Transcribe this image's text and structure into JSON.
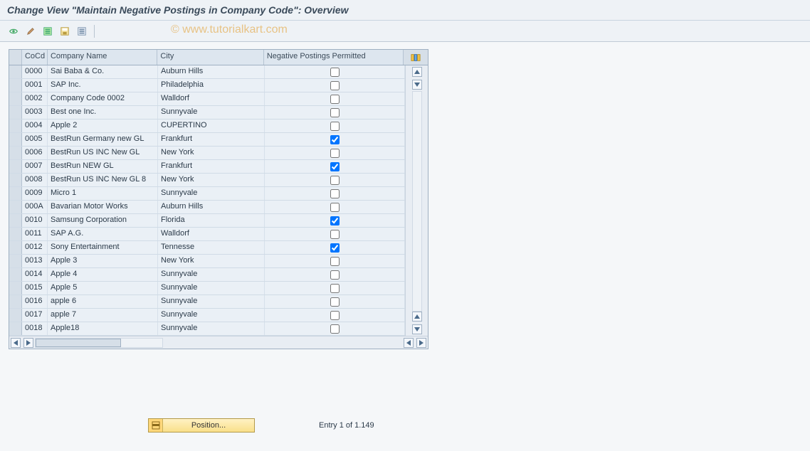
{
  "header": {
    "title": "Change View \"Maintain Negative Postings in Company Code\": Overview"
  },
  "watermark": "© www.tutorialkart.com",
  "toolbar": {
    "icons": [
      {
        "name": "other-view-icon"
      },
      {
        "name": "change-icon"
      },
      {
        "name": "select-all-icon"
      },
      {
        "name": "save-icon"
      },
      {
        "name": "deselect-all-icon"
      }
    ]
  },
  "grid": {
    "columns": {
      "cocd": "CoCd",
      "name": "Company Name",
      "city": "City",
      "neg": "Negative Postings Permitted"
    },
    "config_button": "configure-columns",
    "rows": [
      {
        "cocd": "0000",
        "name": "Sai Baba & Co.",
        "city": "Auburn Hills",
        "neg": false
      },
      {
        "cocd": "0001",
        "name": "SAP Inc.",
        "city": "Philadelphia",
        "neg": false
      },
      {
        "cocd": "0002",
        "name": "Company Code 0002",
        "city": "Walldorf",
        "neg": false
      },
      {
        "cocd": "0003",
        "name": "Best one Inc.",
        "city": "Sunnyvale",
        "neg": false
      },
      {
        "cocd": "0004",
        "name": "Apple 2",
        "city": "CUPERTINO",
        "neg": false
      },
      {
        "cocd": "0005",
        "name": "BestRun Germany new GL",
        "city": "Frankfurt",
        "neg": true
      },
      {
        "cocd": "0006",
        "name": "BestRun US INC New GL",
        "city": "New York",
        "neg": false
      },
      {
        "cocd": "0007",
        "name": "BestRun NEW GL",
        "city": "Frankfurt",
        "neg": true
      },
      {
        "cocd": "0008",
        "name": "BestRun US INC New GL 8",
        "city": "New York",
        "neg": false
      },
      {
        "cocd": "0009",
        "name": "Micro 1",
        "city": "Sunnyvale",
        "neg": false
      },
      {
        "cocd": "000A",
        "name": "Bavarian Motor Works",
        "city": "Auburn Hills",
        "neg": false
      },
      {
        "cocd": "0010",
        "name": "Samsung Corporation",
        "city": "Florida",
        "neg": true
      },
      {
        "cocd": "0011",
        "name": "SAP A.G.",
        "city": "Walldorf",
        "neg": false
      },
      {
        "cocd": "0012",
        "name": "Sony Entertainment",
        "city": "Tennesse",
        "neg": true
      },
      {
        "cocd": "0013",
        "name": "Apple 3",
        "city": "New York",
        "neg": false
      },
      {
        "cocd": "0014",
        "name": "Apple 4",
        "city": "Sunnyvale",
        "neg": false
      },
      {
        "cocd": "0015",
        "name": "Apple 5",
        "city": "Sunnyvale",
        "neg": false
      },
      {
        "cocd": "0016",
        "name": "apple 6",
        "city": "Sunnyvale",
        "neg": false
      },
      {
        "cocd": "0017",
        "name": "apple 7",
        "city": "Sunnyvale",
        "neg": false
      },
      {
        "cocd": "0018",
        "name": "Apple18",
        "city": "Sunnyvale",
        "neg": false
      }
    ]
  },
  "footer": {
    "position_label": "Position...",
    "entry_info": "Entry 1 of 1.149"
  }
}
